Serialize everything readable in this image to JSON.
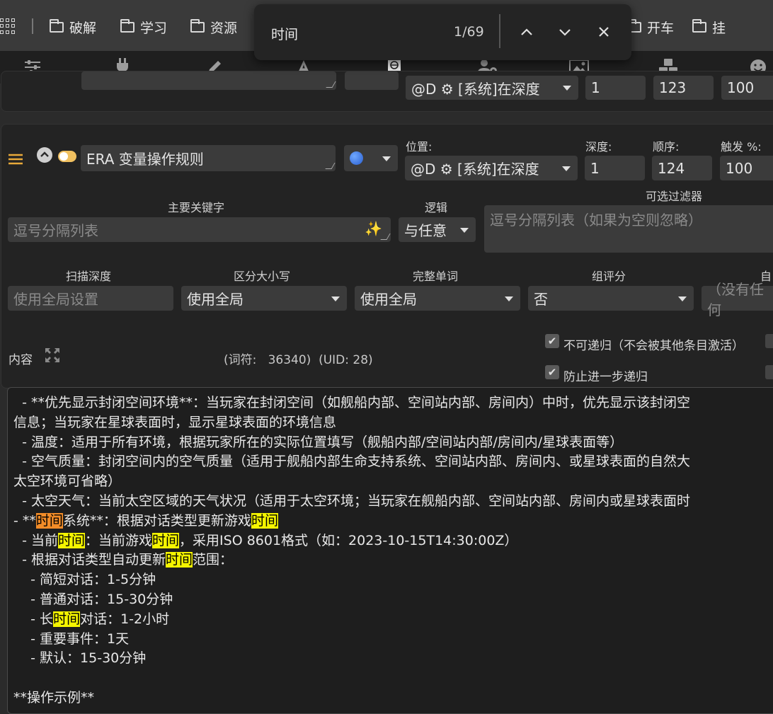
{
  "bookmarks": [
    {
      "label": "破解"
    },
    {
      "label": "学习"
    },
    {
      "label": "资源"
    },
    {
      "label": "开车"
    },
    {
      "label": "挂"
    }
  ],
  "find": {
    "query": "时间",
    "count": "1/69"
  },
  "prev_entry": {
    "position": "@D ⚙ [系统]在深度",
    "depth": "1",
    "order": "123",
    "trigger": "100"
  },
  "entry": {
    "title": "ERA 变量操作规则",
    "position_label": "位置:",
    "position_value": "@D ⚙ [系统]在深度",
    "depth_label": "深度:",
    "depth_value": "1",
    "order_label": "顺序:",
    "order_value": "124",
    "trigger_label": "触发 %:",
    "trigger_value": "100",
    "primary_keywords_label": "主要关键字",
    "primary_keywords_placeholder": "逗号分隔列表",
    "logic_label": "逻辑",
    "logic_value": "与任意",
    "optional_filter_label": "可选过滤器",
    "optional_filter_placeholder": "逗号分隔列表（如果为空则忽略）",
    "scan_depth_label": "扫描深度",
    "scan_depth_placeholder": "使用全局设置",
    "case_label": "区分大小写",
    "case_value": "使用全局",
    "whole_word_label": "完整单词",
    "whole_word_value": "使用全局",
    "group_score_label": "组评分",
    "group_score_value": "否",
    "auto_label": "自",
    "auto_placeholder": "（没有任何",
    "content_label": "内容",
    "token_info": "(词符:   36340)  (UID: 28)",
    "non_recursive_label": "不可递归（不会被其他条目激活）",
    "prevent_recursion_label": "防止进一步递归"
  },
  "content_lines": [
    [
      {
        "t": "  - **优先显示封闭空间环境**：当玩家在封闭空间（如舰船内部、空间站内部、房间内）中时，优先显示该封闭空"
      }
    ],
    [
      {
        "t": "信息；当玩家在星球表面时，显示星球表面的环境信息"
      }
    ],
    [
      {
        "t": "  - 温度：适用于所有环境，根据玩家所在的实际位置填写（舰船内部/空间站内部/房间内/星球表面等）"
      }
    ],
    [
      {
        "t": "  - 空气质量：封闭空间内的空气质量（适用于舰船内部生命支持系统、空间站内部、房间内、或星球表面的自然大"
      }
    ],
    [
      {
        "t": "太空环境可省略）"
      }
    ],
    [
      {
        "t": "  - 太空天气：当前太空区域的天气状况（适用于太空环境；当玩家在舰船内部、空间站内部、房间内或星球表面时"
      }
    ],
    [
      {
        "t": "- **"
      },
      {
        "t": "时间",
        "h": "cur"
      },
      {
        "t": "系统**：根据对话类型更新游戏"
      },
      {
        "t": "时间",
        "h": "hl"
      }
    ],
    [
      {
        "t": "  - 当前"
      },
      {
        "t": "时间",
        "h": "hl"
      },
      {
        "t": "：当前游戏"
      },
      {
        "t": "时间",
        "h": "hl"
      },
      {
        "t": "，采用ISO 8601格式（如：2023-10-15T14:30:00Z）"
      }
    ],
    [
      {
        "t": "  - 根据对话类型自动更新"
      },
      {
        "t": "时间",
        "h": "hl"
      },
      {
        "t": "范围："
      }
    ],
    [
      {
        "t": "    - 简短对话：1-5分钟"
      }
    ],
    [
      {
        "t": "    - 普通对话：15-30分钟"
      }
    ],
    [
      {
        "t": "    - 长"
      },
      {
        "t": "时间",
        "h": "hl"
      },
      {
        "t": "对话：1-2小时"
      }
    ],
    [
      {
        "t": "    - 重要事件：1天"
      }
    ],
    [
      {
        "t": "    - 默认：15-30分钟"
      }
    ],
    [
      {
        "t": ""
      }
    ],
    [
      {
        "t": "**操作示例**"
      }
    ]
  ]
}
